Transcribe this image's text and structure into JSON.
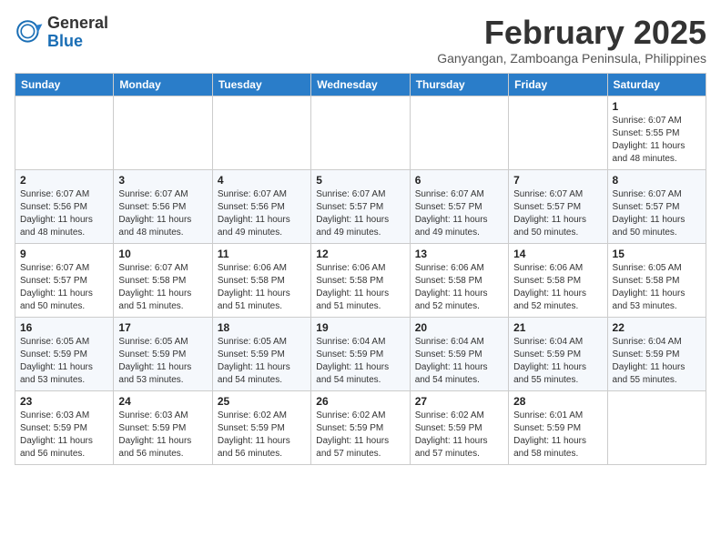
{
  "logo": {
    "general": "General",
    "blue": "Blue"
  },
  "title": {
    "month_year": "February 2025",
    "location": "Ganyangan, Zamboanga Peninsula, Philippines"
  },
  "calendar": {
    "headers": [
      "Sunday",
      "Monday",
      "Tuesday",
      "Wednesday",
      "Thursday",
      "Friday",
      "Saturday"
    ],
    "weeks": [
      [
        {
          "day": "",
          "info": ""
        },
        {
          "day": "",
          "info": ""
        },
        {
          "day": "",
          "info": ""
        },
        {
          "day": "",
          "info": ""
        },
        {
          "day": "",
          "info": ""
        },
        {
          "day": "",
          "info": ""
        },
        {
          "day": "1",
          "info": "Sunrise: 6:07 AM\nSunset: 5:55 PM\nDaylight: 11 hours\nand 48 minutes."
        }
      ],
      [
        {
          "day": "2",
          "info": "Sunrise: 6:07 AM\nSunset: 5:56 PM\nDaylight: 11 hours\nand 48 minutes."
        },
        {
          "day": "3",
          "info": "Sunrise: 6:07 AM\nSunset: 5:56 PM\nDaylight: 11 hours\nand 48 minutes."
        },
        {
          "day": "4",
          "info": "Sunrise: 6:07 AM\nSunset: 5:56 PM\nDaylight: 11 hours\nand 49 minutes."
        },
        {
          "day": "5",
          "info": "Sunrise: 6:07 AM\nSunset: 5:57 PM\nDaylight: 11 hours\nand 49 minutes."
        },
        {
          "day": "6",
          "info": "Sunrise: 6:07 AM\nSunset: 5:57 PM\nDaylight: 11 hours\nand 49 minutes."
        },
        {
          "day": "7",
          "info": "Sunrise: 6:07 AM\nSunset: 5:57 PM\nDaylight: 11 hours\nand 50 minutes."
        },
        {
          "day": "8",
          "info": "Sunrise: 6:07 AM\nSunset: 5:57 PM\nDaylight: 11 hours\nand 50 minutes."
        }
      ],
      [
        {
          "day": "9",
          "info": "Sunrise: 6:07 AM\nSunset: 5:57 PM\nDaylight: 11 hours\nand 50 minutes."
        },
        {
          "day": "10",
          "info": "Sunrise: 6:07 AM\nSunset: 5:58 PM\nDaylight: 11 hours\nand 51 minutes."
        },
        {
          "day": "11",
          "info": "Sunrise: 6:06 AM\nSunset: 5:58 PM\nDaylight: 11 hours\nand 51 minutes."
        },
        {
          "day": "12",
          "info": "Sunrise: 6:06 AM\nSunset: 5:58 PM\nDaylight: 11 hours\nand 51 minutes."
        },
        {
          "day": "13",
          "info": "Sunrise: 6:06 AM\nSunset: 5:58 PM\nDaylight: 11 hours\nand 52 minutes."
        },
        {
          "day": "14",
          "info": "Sunrise: 6:06 AM\nSunset: 5:58 PM\nDaylight: 11 hours\nand 52 minutes."
        },
        {
          "day": "15",
          "info": "Sunrise: 6:05 AM\nSunset: 5:58 PM\nDaylight: 11 hours\nand 53 minutes."
        }
      ],
      [
        {
          "day": "16",
          "info": "Sunrise: 6:05 AM\nSunset: 5:59 PM\nDaylight: 11 hours\nand 53 minutes."
        },
        {
          "day": "17",
          "info": "Sunrise: 6:05 AM\nSunset: 5:59 PM\nDaylight: 11 hours\nand 53 minutes."
        },
        {
          "day": "18",
          "info": "Sunrise: 6:05 AM\nSunset: 5:59 PM\nDaylight: 11 hours\nand 54 minutes."
        },
        {
          "day": "19",
          "info": "Sunrise: 6:04 AM\nSunset: 5:59 PM\nDaylight: 11 hours\nand 54 minutes."
        },
        {
          "day": "20",
          "info": "Sunrise: 6:04 AM\nSunset: 5:59 PM\nDaylight: 11 hours\nand 54 minutes."
        },
        {
          "day": "21",
          "info": "Sunrise: 6:04 AM\nSunset: 5:59 PM\nDaylight: 11 hours\nand 55 minutes."
        },
        {
          "day": "22",
          "info": "Sunrise: 6:04 AM\nSunset: 5:59 PM\nDaylight: 11 hours\nand 55 minutes."
        }
      ],
      [
        {
          "day": "23",
          "info": "Sunrise: 6:03 AM\nSunset: 5:59 PM\nDaylight: 11 hours\nand 56 minutes."
        },
        {
          "day": "24",
          "info": "Sunrise: 6:03 AM\nSunset: 5:59 PM\nDaylight: 11 hours\nand 56 minutes."
        },
        {
          "day": "25",
          "info": "Sunrise: 6:02 AM\nSunset: 5:59 PM\nDaylight: 11 hours\nand 56 minutes."
        },
        {
          "day": "26",
          "info": "Sunrise: 6:02 AM\nSunset: 5:59 PM\nDaylight: 11 hours\nand 57 minutes."
        },
        {
          "day": "27",
          "info": "Sunrise: 6:02 AM\nSunset: 5:59 PM\nDaylight: 11 hours\nand 57 minutes."
        },
        {
          "day": "28",
          "info": "Sunrise: 6:01 AM\nSunset: 5:59 PM\nDaylight: 11 hours\nand 58 minutes."
        },
        {
          "day": "",
          "info": ""
        }
      ]
    ]
  }
}
